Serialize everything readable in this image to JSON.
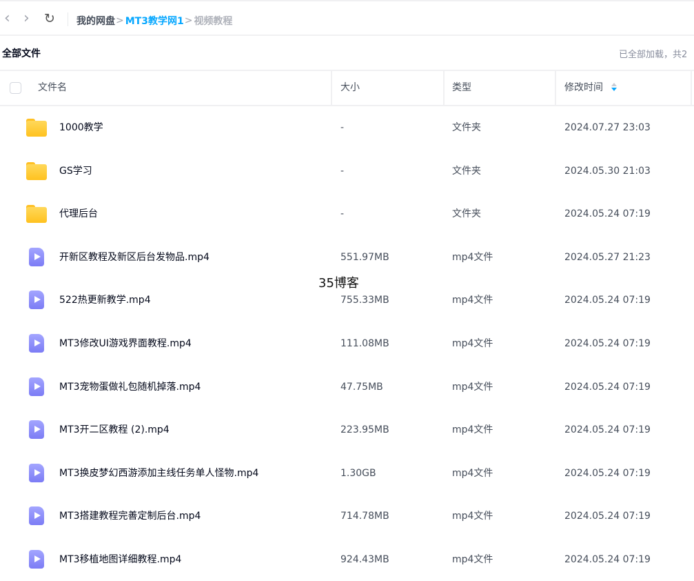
{
  "breadcrumb": {
    "items": [
      "我的网盘",
      "MT3教学网1",
      "视频教程"
    ],
    "separator": ">"
  },
  "section_title": "全部文件",
  "load_status": "已全部加载，共2",
  "columns": {
    "name": "文件名",
    "size": "大小",
    "type": "类型",
    "modified": "修改时间"
  },
  "files": [
    {
      "icon": "folder-icon",
      "name": "1000教学",
      "size": "-",
      "type": "文件夹",
      "time": "2024.07.27 23:03"
    },
    {
      "icon": "folder-icon",
      "name": "GS学习",
      "size": "-",
      "type": "文件夹",
      "time": "2024.05.30 21:03"
    },
    {
      "icon": "folder-icon",
      "name": "代理后台",
      "size": "-",
      "type": "文件夹",
      "time": "2024.05.24 07:19"
    },
    {
      "icon": "video-file-icon",
      "name": "开新区教程及新区后台发物品.mp4",
      "size": "551.97MB",
      "type": "mp4文件",
      "time": "2024.05.27 21:23"
    },
    {
      "icon": "video-file-icon",
      "name": "522热更新教学.mp4",
      "size": "755.33MB",
      "type": "mp4文件",
      "time": "2024.05.24 07:19"
    },
    {
      "icon": "video-file-icon",
      "name": "MT3修改UI游戏界面教程.mp4",
      "size": "111.08MB",
      "type": "mp4文件",
      "time": "2024.05.24 07:19"
    },
    {
      "icon": "video-file-icon",
      "name": "MT3宠物蛋做礼包随机掉落.mp4",
      "size": "47.75MB",
      "type": "mp4文件",
      "time": "2024.05.24 07:19"
    },
    {
      "icon": "video-file-icon",
      "name": "MT3开二区教程 (2).mp4",
      "size": "223.95MB",
      "type": "mp4文件",
      "time": "2024.05.24 07:19"
    },
    {
      "icon": "video-file-icon",
      "name": "MT3换皮梦幻西游添加主线任务单人怪物.mp4",
      "size": "1.30GB",
      "type": "mp4文件",
      "time": "2024.05.24 07:19"
    },
    {
      "icon": "video-file-icon",
      "name": "MT3搭建教程完善定制后台.mp4",
      "size": "714.78MB",
      "type": "mp4文件",
      "time": "2024.05.24 07:19"
    },
    {
      "icon": "video-file-icon",
      "name": "MT3移植地图详细教程.mp4",
      "size": "924.43MB",
      "type": "mp4文件",
      "time": "2024.05.24 07:19"
    }
  ],
  "watermark": "35博客"
}
